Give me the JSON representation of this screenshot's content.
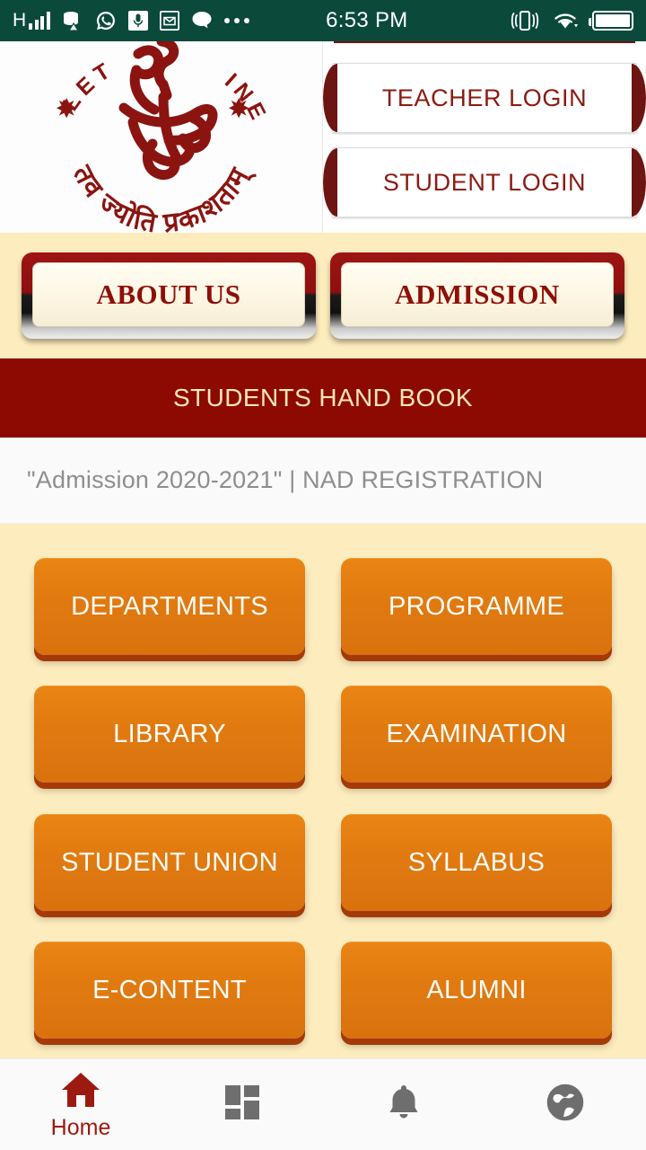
{
  "status_bar": {
    "network_type": "H",
    "signal_bars": 4,
    "time": "6:53 PM",
    "icons": [
      "database-sync-icon",
      "whatsapp-icon",
      "microphone-icon",
      "mail-icon",
      "chat-bubble-icon",
      "more-dots-icon",
      "vibrate-icon",
      "wifi-icon",
      "battery-icon"
    ],
    "colors": {
      "background": "#0b4a3b",
      "foreground": "#ffffff"
    }
  },
  "header": {
    "logo": {
      "name": "college-emblem-logo",
      "arc_top_text": "LET ... SHINE",
      "arc_bottom_text": "तव ज्योति प्रकाशताम्",
      "color": "#8b1410"
    },
    "login_buttons": [
      {
        "label": "TEACHER LOGIN"
      },
      {
        "label": "STUDENT LOGIN"
      }
    ]
  },
  "quick_actions": [
    {
      "label": "ABOUT US"
    },
    {
      "label": "ADMISSION"
    }
  ],
  "handbook": {
    "label": "STUDENTS HAND BOOK"
  },
  "marquee": {
    "text": "\"Admission 2020-2021\"  |  NAD REGISTRATION"
  },
  "grid": {
    "tiles": [
      {
        "label": "DEPARTMENTS"
      },
      {
        "label": "PROGRAMME"
      },
      {
        "label": "LIBRARY"
      },
      {
        "label": "EXAMINATION"
      },
      {
        "label": "STUDENT UNION"
      },
      {
        "label": "SYLLABUS"
      },
      {
        "label": "E-CONTENT"
      },
      {
        "label": "ALUMNI"
      }
    ]
  },
  "bottom_nav": {
    "items": [
      {
        "icon": "home-icon",
        "label": "Home",
        "active": true
      },
      {
        "icon": "dashboard-grid-icon",
        "label": "",
        "active": false
      },
      {
        "icon": "bell-icon",
        "label": "",
        "active": false
      },
      {
        "icon": "globe-icon",
        "label": "",
        "active": false
      }
    ]
  },
  "colors": {
    "status_green": "#0b4a3b",
    "brand_dark_red": "#8c0a02",
    "cream_bg": "#fdecbd",
    "tile_orange": "#e07a10",
    "tile_shadow": "#a33a07",
    "nav_active": "#9c1a10",
    "nav_inactive": "#6e6e6e"
  }
}
